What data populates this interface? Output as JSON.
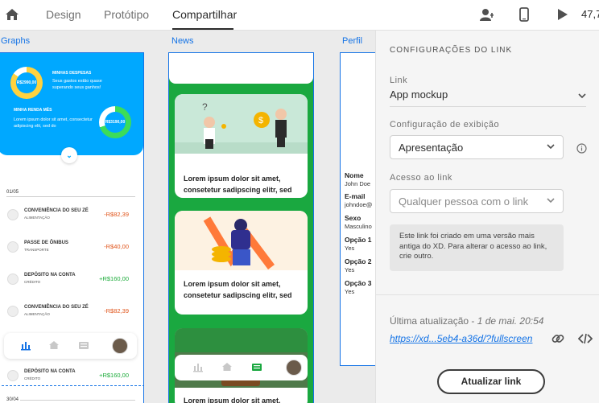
{
  "topbar": {
    "tabs": [
      {
        "label": "Design",
        "active": false
      },
      {
        "label": "Protótipo",
        "active": false
      },
      {
        "label": "Compartilhar",
        "active": true
      }
    ],
    "zoom": "47,7"
  },
  "canvas": {
    "artboards": [
      {
        "name": "Graphs"
      },
      {
        "name": "News"
      },
      {
        "name": "Perfil"
      }
    ],
    "graphs": {
      "hero": {
        "value1": "R$2990,00",
        "title1": "MINHAS DESPESAS",
        "text1": "Seus gastos estão quase superando seus ganhos!",
        "title2": "MINHA RENDA MÊS",
        "text2": "Lorem ipsum dolor sit amet, consectetur adipiscing elit, sed do",
        "value2": "R$3190,00"
      },
      "dates": [
        "01/05",
        "30/04"
      ],
      "transactions": [
        {
          "title": "CONVENIÊNCIA DO SEU ZÉ",
          "category": "ALIMENTAÇÃO",
          "value": "-R$82,39",
          "type": "neg"
        },
        {
          "title": "PASSE DE ÔNIBUS",
          "category": "TRANSPORTE",
          "value": "-R$40,00",
          "type": "neg"
        },
        {
          "title": "DEPÓSITO NA CONTA",
          "category": "CRÉDITO",
          "value": "+R$160,00",
          "type": "pos"
        },
        {
          "title": "CONVENIÊNCIA DO SEU ZÉ",
          "category": "ALIMENTAÇÃO",
          "value": "-R$82,39",
          "type": "neg"
        },
        {
          "title": "DEPÓSITO NA CONTA",
          "category": "CRÉDITO",
          "value": "+R$160,00",
          "type": "pos"
        }
      ]
    },
    "news": {
      "cards": [
        {
          "text": "Lorem ipsum dolor sit amet, consetetur sadipscing elitr, sed"
        },
        {
          "text": "Lorem ipsum dolor sit amet, consetetur sadipscing elitr, sed"
        },
        {
          "text": "Lorem ipsum dolor sit amet,"
        }
      ]
    },
    "perfil": {
      "fields": [
        {
          "label": "Nome",
          "value": "John Doe"
        },
        {
          "label": "E-mail",
          "value": "johndoe@"
        },
        {
          "label": "Sexo",
          "value": "Masculino"
        },
        {
          "label": "Opção 1",
          "value": "Yes"
        },
        {
          "label": "Opção 2",
          "value": "Yes"
        },
        {
          "label": "Opção 3",
          "value": "Yes"
        }
      ]
    }
  },
  "panel": {
    "title": "CONFIGURAÇÕES DO LINK",
    "link_label": "Link",
    "link_value": "App mockup",
    "display_label": "Configuração de exibição",
    "display_value": "Apresentação",
    "access_label": "Acesso ao link",
    "access_placeholder": "Qualquer pessoa com o link",
    "info": "Este link foi criado em uma versão mais antiga do XD. Para alterar o acesso ao link, crie outro.",
    "updated_label": "Última atualização - ",
    "updated_date": "1 de mai. 20:54",
    "url": "https://xd...5eb4-a36d/?fullscreen",
    "update_button": "Atualizar link"
  },
  "colors": {
    "accent": "#1473e6",
    "hero_blue": "#00a8ff",
    "news_green": "#1aa840",
    "negative": "#e0541a",
    "positive": "#1cab3a"
  }
}
